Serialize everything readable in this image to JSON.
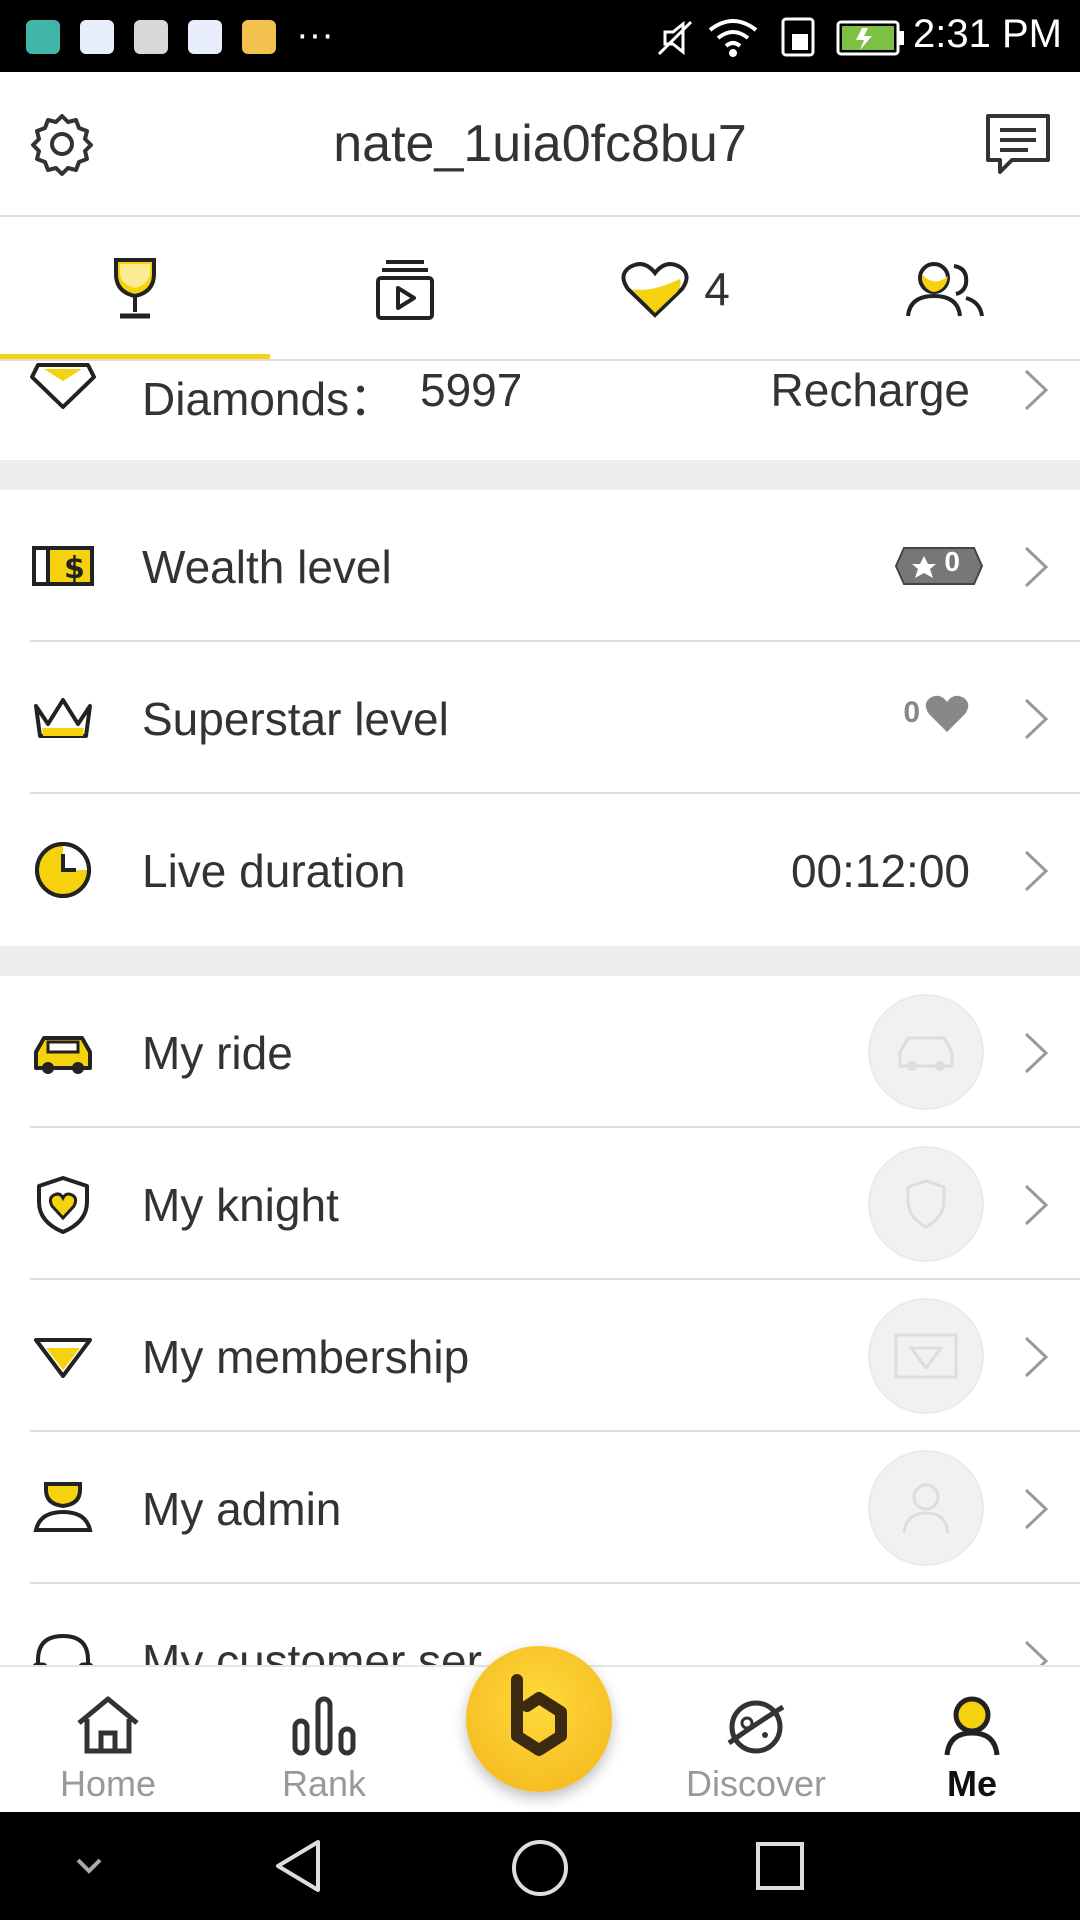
{
  "status_bar": {
    "time": "2:31 PM",
    "more": "···"
  },
  "header": {
    "title": "nate_1uia0fc8bu7"
  },
  "tabs": [
    {
      "icon": "trophy-icon"
    },
    {
      "icon": "video-icon"
    },
    {
      "icon": "heart-icon",
      "count": "4"
    },
    {
      "icon": "people-icon"
    }
  ],
  "diamonds": {
    "label": "Diamonds：",
    "value": "5997",
    "action": "Recharge"
  },
  "levels": {
    "wealth": {
      "label": "Wealth level",
      "badge": "0"
    },
    "superstar": {
      "label": "Superstar level",
      "badge": "0"
    },
    "live": {
      "label": "Live duration",
      "value": "00:12:00"
    }
  },
  "items": {
    "ride": "My ride",
    "knight": "My knight",
    "membership": "My membership",
    "admin": "My admin",
    "customer": "My customer ser"
  },
  "bottom_nav": {
    "home": "Home",
    "rank": "Rank",
    "discover": "Discover",
    "me": "Me"
  },
  "colors": {
    "accent": "#f5d20d",
    "link": "#3a9de0",
    "text": "#333333"
  }
}
